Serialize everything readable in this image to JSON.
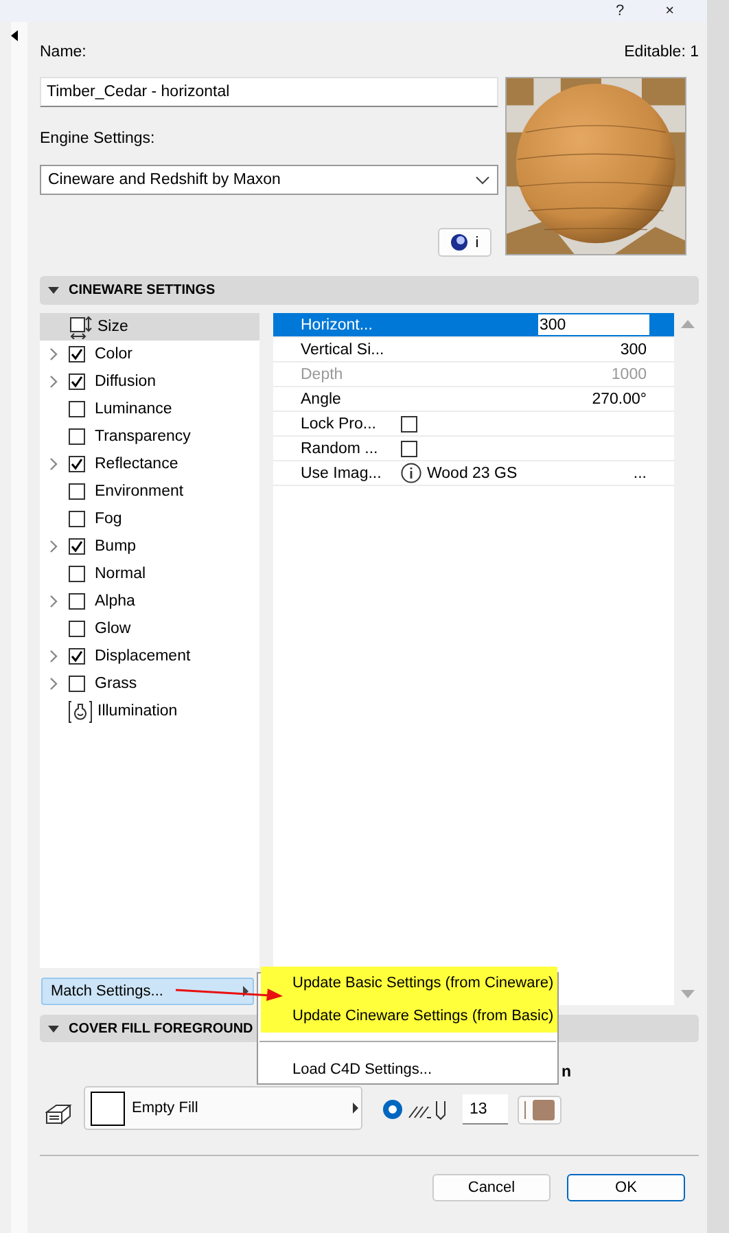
{
  "window": {
    "help": "?",
    "close": "×"
  },
  "name_label": "Name:",
  "editable": "Editable: 1",
  "name_value": "Timber_Cedar - horizontal",
  "engine_label": "Engine Settings:",
  "engine_value": "Cineware and Redshift by Maxon",
  "info_button": "i",
  "cineware": {
    "title": "CINEWARE SETTINGS",
    "expanded": true,
    "channels": [
      {
        "label": "Size",
        "kind": "size",
        "expandable": false,
        "selected": true
      },
      {
        "label": "Color",
        "kind": "channel",
        "expandable": true,
        "checked": true,
        "selected": false
      },
      {
        "label": "Diffusion",
        "kind": "channel",
        "expandable": true,
        "checked": true,
        "selected": false
      },
      {
        "label": "Luminance",
        "kind": "channel",
        "expandable": false,
        "checked": false,
        "selected": false
      },
      {
        "label": "Transparency",
        "kind": "channel",
        "expandable": false,
        "checked": false,
        "selected": false
      },
      {
        "label": "Reflectance",
        "kind": "channel",
        "expandable": true,
        "checked": true,
        "selected": false
      },
      {
        "label": "Environment",
        "kind": "channel",
        "expandable": false,
        "checked": false,
        "selected": false
      },
      {
        "label": "Fog",
        "kind": "channel",
        "expandable": false,
        "checked": false,
        "selected": false
      },
      {
        "label": "Bump",
        "kind": "channel",
        "expandable": true,
        "checked": true,
        "selected": false
      },
      {
        "label": "Normal",
        "kind": "channel",
        "expandable": false,
        "checked": false,
        "selected": false
      },
      {
        "label": "Alpha",
        "kind": "channel",
        "expandable": true,
        "checked": false,
        "selected": false
      },
      {
        "label": "Glow",
        "kind": "channel",
        "expandable": false,
        "checked": false,
        "selected": false
      },
      {
        "label": "Displacement",
        "kind": "channel",
        "expandable": true,
        "checked": true,
        "selected": false
      },
      {
        "label": "Grass",
        "kind": "channel",
        "expandable": true,
        "checked": false,
        "selected": false
      },
      {
        "label": "Illumination",
        "kind": "illumination",
        "expandable": false,
        "selected": false
      }
    ],
    "properties": [
      {
        "label": "Horizont...",
        "kind": "value",
        "value": "300",
        "selected": true,
        "disabled": false
      },
      {
        "label": "Vertical Si...",
        "kind": "value",
        "value": "300",
        "selected": false,
        "disabled": false
      },
      {
        "label": "Depth",
        "kind": "value",
        "value": "1000",
        "selected": false,
        "disabled": true
      },
      {
        "label": "Angle",
        "kind": "value",
        "value": "270.00°",
        "selected": false,
        "disabled": false
      },
      {
        "label": "Lock Pro...",
        "kind": "checkbox",
        "checked": false,
        "selected": false,
        "disabled": false
      },
      {
        "label": "Random ...",
        "kind": "checkbox",
        "checked": false,
        "selected": false,
        "disabled": false
      },
      {
        "label": "Use Imag...",
        "value": "Wood 23 GS",
        "more": "...",
        "selected": false,
        "disabled": false
      }
    ]
  },
  "match_button": "Match Settings...",
  "menu": {
    "items": [
      {
        "label": "Update Basic Settings (from Cineware)",
        "highlighted": true
      },
      {
        "label": "Update Cineware Settings (from Basic)",
        "highlighted": true
      },
      {
        "label": "Load C4D Settings...",
        "highlighted": false
      }
    ]
  },
  "cover_fill": {
    "title": "COVER FILL FOREGROUND",
    "expanded": true,
    "fill": "Empty Fill",
    "fragment": "n",
    "pen": "13",
    "radio_selected": true
  },
  "buttons": [
    {
      "label": "Cancel",
      "default": false
    },
    {
      "label": "OK",
      "default": true
    }
  ]
}
